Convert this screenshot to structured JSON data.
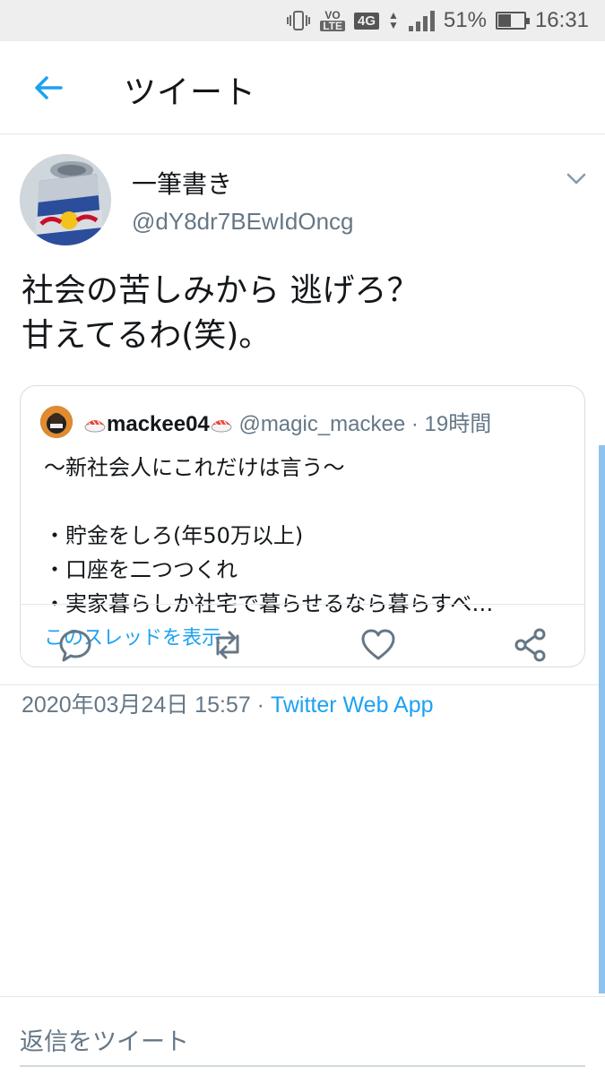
{
  "status_bar": {
    "volte_top": "VO",
    "volte_bottom": "LTE",
    "network": "4G",
    "battery_level": 0.51,
    "battery": "51%",
    "time": "16:31"
  },
  "header": {
    "back_icon": "arrow-left-icon",
    "title": "ツイート"
  },
  "tweet": {
    "display_name": "一筆書き",
    "handle": "@dY8dr7BEwIdOncg",
    "text": "社会の苦しみから 逃げろ？\n甘えてるわ(笑)。",
    "timestamp": "2020年03月24日 15:57 · ",
    "source": "Twitter Web App"
  },
  "quoted_tweet": {
    "display_name": "mackee04",
    "handle_and_time": " @magic_mackee · 19時間",
    "text": "〜新社会人にこれだけは言う〜\n\n・貯金をしろ(年50万以上)\n・口座を二つつくれ\n・実家暮らしか社宅で暮らせるなら暮らすべ…",
    "show_thread": "このスレッドを表示"
  },
  "actions": [
    "reply-icon",
    "retweet-icon",
    "like-icon",
    "share-icon"
  ],
  "reply": {
    "placeholder": "返信をツイート"
  },
  "colors": {
    "accent": "#1da1f2",
    "secondary_text": "#657786",
    "border": "#e1e8ed"
  }
}
